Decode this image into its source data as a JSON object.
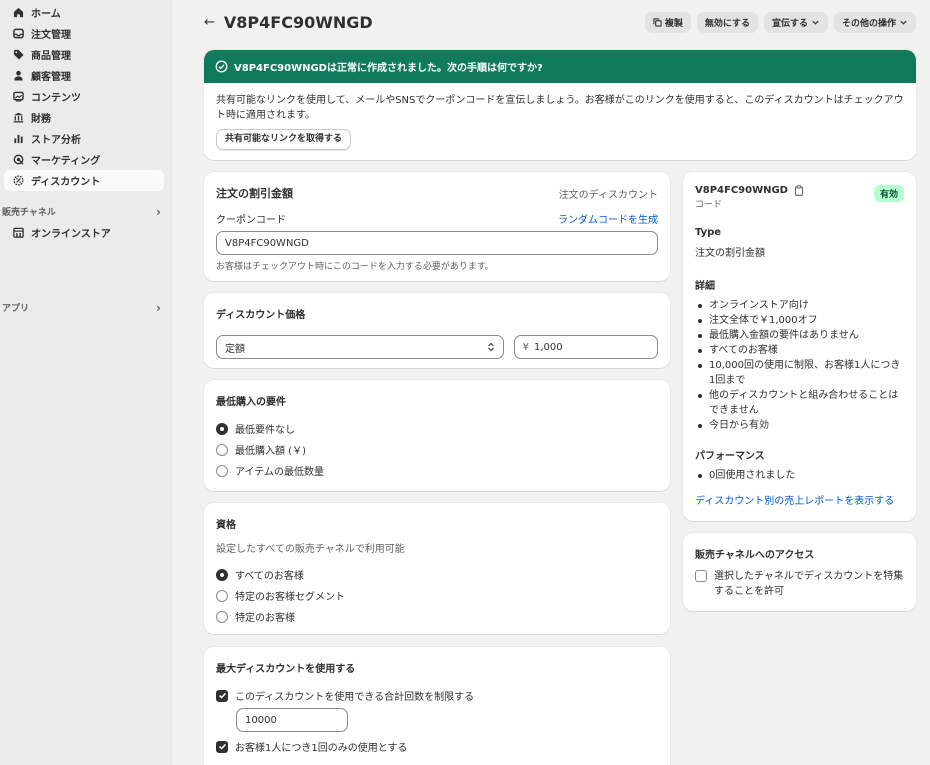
{
  "sidebar": {
    "items": [
      {
        "label": "ホーム",
        "icon": "home-icon"
      },
      {
        "label": "注文管理",
        "icon": "inbox-icon"
      },
      {
        "label": "商品管理",
        "icon": "tag-icon"
      },
      {
        "label": "顧客管理",
        "icon": "person-icon"
      },
      {
        "label": "コンテンツ",
        "icon": "image-icon"
      },
      {
        "label": "財務",
        "icon": "bank-icon"
      },
      {
        "label": "ストア分析",
        "icon": "chart-bar-icon"
      },
      {
        "label": "マーケティング",
        "icon": "target-icon"
      },
      {
        "label": "ディスカウント",
        "icon": "discount-icon"
      }
    ],
    "sales_channels": {
      "label": "販売チャネル",
      "items": [
        {
          "label": "オンラインストア",
          "icon": "store-icon"
        }
      ]
    },
    "apps": {
      "label": "アプリ"
    }
  },
  "header": {
    "title": "V8P4FC90WNGD",
    "actions": {
      "duplicate": "複製",
      "deactivate": "無効にする",
      "promote": "宣伝する",
      "more": "その他の操作"
    }
  },
  "banner": {
    "title": "V8P4FC90WNGDは正常に作成されました。次の手順は何ですか?",
    "body": "共有可能なリンクを使用して、メールやSNSでクーポンコードを宣伝しましょう。お客様がこのリンクを使用すると、このディスカウントはチェックアウト時に適用されます。",
    "button": "共有可能なリンクを取得する"
  },
  "discount_card": {
    "title": "注文の割引金額",
    "type_label": "注文のディスカウント",
    "code_label": "クーポンコード",
    "random_link": "ランダムコードを生成",
    "code_value": "V8P4FC90WNGD",
    "help": "お客様はチェックアウト時にこのコードを入力する必要があります。"
  },
  "value_card": {
    "title": "ディスカウント価格",
    "select_value": "定額",
    "currency": "¥",
    "amount": "1,000"
  },
  "min_req_card": {
    "title": "最低購入の要件",
    "options": [
      "最低要件なし",
      "最低購入額 (￥)",
      "アイテムの最低数量"
    ],
    "selected": 0
  },
  "eligibility_card": {
    "title": "資格",
    "subtitle": "設定したすべての販売チャネルで利用可能",
    "options": [
      "すべてのお客様",
      "特定のお客様セグメント",
      "特定のお客様"
    ],
    "selected": 0
  },
  "max_uses_card": {
    "title": "最大ディスカウントを使用する",
    "limit_total_label": "このディスカウントを使用できる合計回数を制限する",
    "limit_total_value": "10000",
    "one_per_customer_label": "お客様1人につき1回のみの使用とする"
  },
  "summary": {
    "code": "V8P4FC90WNGD",
    "code_caption": "コード",
    "status": "有効",
    "type_title": "Type",
    "type_value": "注文の割引金額",
    "details_title": "詳細",
    "details": [
      "オンラインストア向け",
      "注文全体で￥1,000オフ",
      "最低購入金額の要件はありません",
      "すべてのお客様",
      "10,000回の使用に制限、お客様1人につき1回まで",
      "他のディスカウントと組み合わせることはできません",
      "今日から有効"
    ],
    "performance_title": "パフォーマンス",
    "performance": [
      "0回使用されました"
    ],
    "report_link": "ディスカウント別の売上レポートを表示する"
  },
  "channel_card": {
    "title": "販売チャネルへのアクセス",
    "checkbox_label": "選択したチャネルでディスカウントを特集することを許可"
  },
  "colors": {
    "banner": "#0f7b5c",
    "link": "#005bd3",
    "badge_bg": "#b4fed2"
  }
}
